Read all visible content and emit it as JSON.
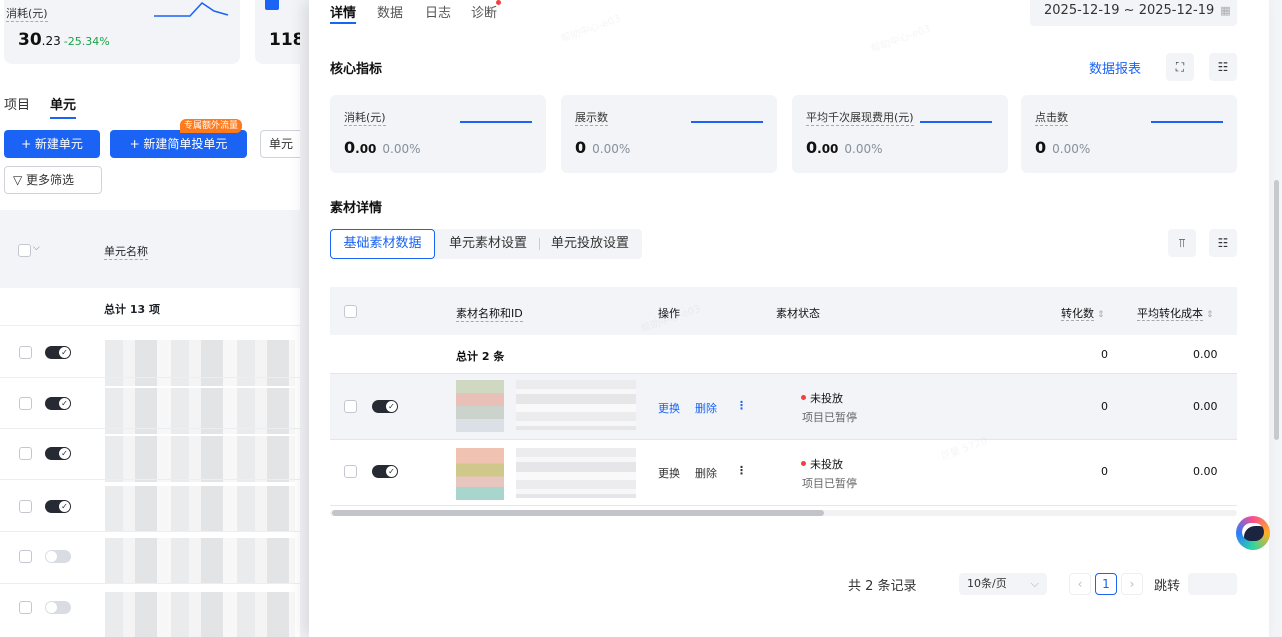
{
  "left_panel": {
    "metric1": {
      "label": "消耗(元)",
      "int": "30",
      "dec": ".23",
      "change": "-25.34%"
    },
    "metric2": {
      "value": "118"
    },
    "tabs": [
      "项目",
      "单元"
    ],
    "new_unit": "+ 新建单元",
    "new_simple_unit": "+ 新建简单投单元",
    "hot_badge": "专属额外流量",
    "unit_partial": "单元",
    "more_filter": "更多筛选",
    "col_name": "单元名称",
    "total": "总计 13 项",
    "rows": [
      {
        "on": true
      },
      {
        "on": true
      },
      {
        "on": true
      },
      {
        "on": true
      },
      {
        "on": false
      },
      {
        "on": false
      }
    ]
  },
  "drawer": {
    "tabs": [
      "详情",
      "数据",
      "日志",
      "诊断"
    ],
    "date_range": "2025-12-19  ~  2025-12-19",
    "core_title": "核心指标",
    "report_link": "数据报表",
    "kpis": [
      {
        "label": "消耗(元)",
        "int": "0",
        ".dec": "",
        "dec": ".00",
        "pct": "0.00%"
      },
      {
        "label": "展示数",
        "int": "0",
        "dec": "",
        "pct": "0.00%"
      },
      {
        "label": "平均千次展现费用(元)",
        "int": "0",
        "dec": ".00",
        "pct": "0.00%"
      },
      {
        "label": "点击数",
        "int": "0",
        "dec": "",
        "pct": "0.00%"
      }
    ],
    "material_title": "素材详情",
    "segments": [
      "基础素材数据",
      "单元素材设置",
      "单元投放设置"
    ],
    "columns": {
      "name": "素材名称和ID",
      "ops": "操作",
      "status": "素材状态",
      "conv": "转化数",
      "cost": "平均转化成本"
    },
    "total_row": {
      "label": "总计 2 条",
      "conv": "0",
      "cost": "0.00"
    },
    "rows": [
      {
        "op_replace": "更换",
        "op_delete": "删除",
        "status": "未投放",
        "sub": "项目已暂停",
        "conv": "0",
        "cost": "0.00"
      },
      {
        "op_replace": "更换",
        "op_delete": "删除",
        "status": "未投放",
        "sub": "项目已暂停",
        "conv": "0",
        "cost": "0.00"
      }
    ],
    "pagination": {
      "total": "共 2 条记录",
      "page_size": "10条/页",
      "current": "1",
      "jump": "跳转"
    }
  },
  "watermark": "帮助中心-e03",
  "watermark2": "巨量 5720",
  "colors": {
    "accent": "#1a63f5",
    "danger": "#f53f3f",
    "positive": "#1aa34a"
  }
}
